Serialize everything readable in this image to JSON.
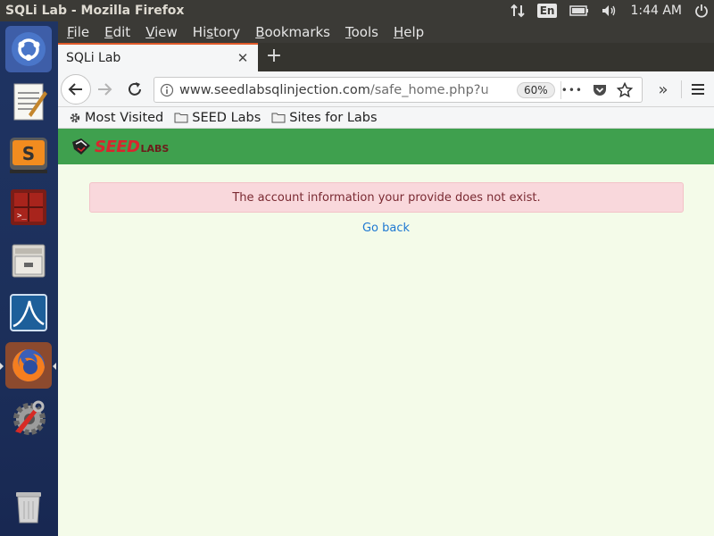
{
  "panel": {
    "window_title": "SQLi Lab - Mozilla Firefox",
    "lang": "En",
    "clock": "1:44 AM"
  },
  "menubar": {
    "items": [
      {
        "label": "File",
        "mnemonic": "F"
      },
      {
        "label": "Edit",
        "mnemonic": "E"
      },
      {
        "label": "View",
        "mnemonic": "V"
      },
      {
        "label": "History",
        "mnemonic": "s"
      },
      {
        "label": "Bookmarks",
        "mnemonic": "B"
      },
      {
        "label": "Tools",
        "mnemonic": "T"
      },
      {
        "label": "Help",
        "mnemonic": "H"
      }
    ]
  },
  "tab": {
    "title": "SQLi Lab",
    "close_glyph": "✕",
    "new_tab_glyph": "+"
  },
  "navbar": {
    "url_host": "www.seedlabsqlinjection.com",
    "url_path": "/safe_home.php?u",
    "zoom": "60%",
    "page_actions_glyph": "•••",
    "overflow_glyph": "»"
  },
  "bookmarks": {
    "items": [
      {
        "label": "Most Visited",
        "icon": "gear-icon"
      },
      {
        "label": "SEED Labs",
        "icon": "folder-icon"
      },
      {
        "label": "Sites for Labs",
        "icon": "folder-icon"
      }
    ]
  },
  "page": {
    "logo_main": "SEED",
    "logo_sub": "LABS",
    "alert_message": "The account information your provide does not exist.",
    "go_back_label": "Go back"
  },
  "launcher": {
    "items": [
      "ubuntu-dash-icon",
      "text-editor-icon",
      "sublime-text-icon",
      "terminal-icon",
      "file-manager-icon",
      "wireshark-icon",
      "firefox-icon",
      "system-settings-icon",
      "trash-icon"
    ]
  },
  "colors": {
    "panel_bg": "#3b3a36",
    "launcher_bg": "#1f3463",
    "page_bg": "#f4fbe9",
    "header_green": "#3fa04e",
    "alert_bg": "#f9d8dc",
    "alert_text": "#7a2a32",
    "link": "#1e78d2",
    "tab_accent": "#e05a2a"
  }
}
